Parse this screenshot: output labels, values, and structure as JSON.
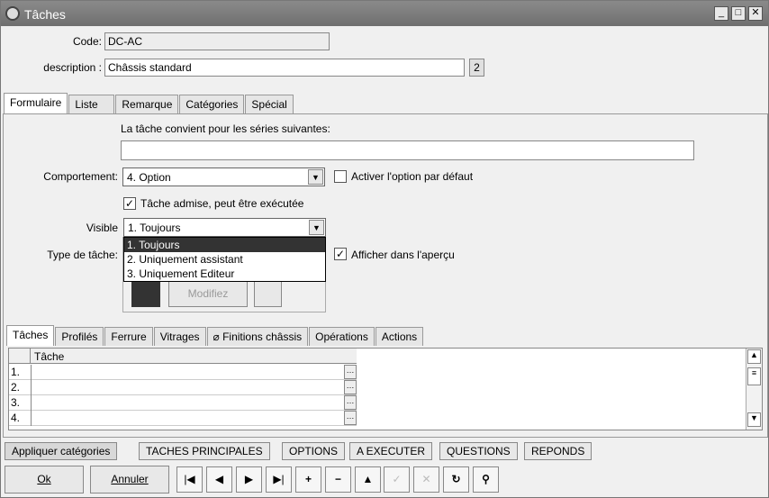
{
  "window": {
    "title": "Tâches"
  },
  "form": {
    "code_label": "Code:",
    "code_value": "DC-AC",
    "description_label": "description :",
    "description_value": "Châssis standard",
    "description_badge": "2"
  },
  "tabs": [
    "Formulaire",
    "Liste",
    "Remarque",
    "Catégories",
    "Spécial"
  ],
  "formulaire": {
    "series_caption": "La tâche convient pour les séries suivantes:",
    "series_value": "",
    "comportement_label": "Comportement:",
    "comportement_value": "4.  Option",
    "activer_label": "Activer l'option par défaut",
    "admise_label": "Tâche admise, peut être exécutée",
    "visible_label": "Visible",
    "visible_value": "1.  Toujours",
    "visible_options": [
      "1.  Toujours",
      "2.  Uniquement assistant",
      "3.  Uniquement Editeur"
    ],
    "type_label": "Type de tâche:",
    "afficher_label": "Afficher dans l'aperçu",
    "modifiez_label": "Modifiez"
  },
  "subtabs": [
    "Tâches",
    "Profilés",
    "Ferrure",
    "Vitrages",
    "Finitions châssis",
    "Opérations",
    "Actions"
  ],
  "table": {
    "column": "Tâche",
    "rows": [
      "1.",
      "2.",
      "3.",
      "4."
    ]
  },
  "bottom_tabs": [
    "Appliquer catégories",
    "TACHES PRINCIPALES",
    "OPTIONS",
    "A EXECUTER",
    "QUESTIONS",
    "REPONDS"
  ],
  "buttons": {
    "ok": "Ok",
    "annuler": "Annuler"
  }
}
